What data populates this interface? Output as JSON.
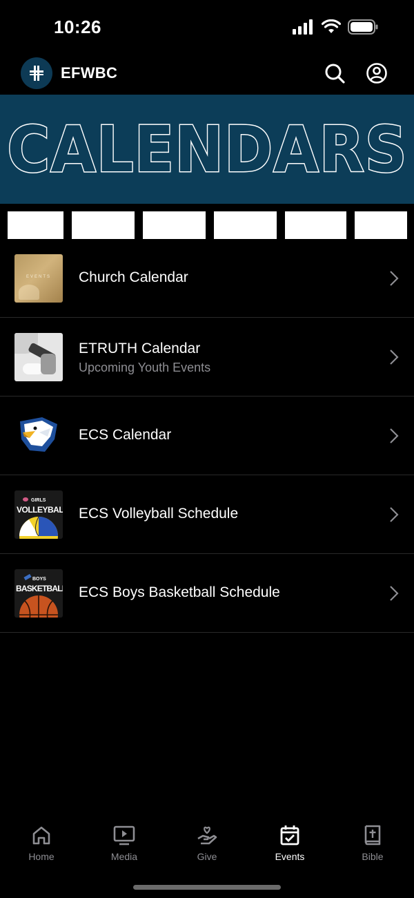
{
  "status": {
    "time": "10:26"
  },
  "header": {
    "app_name": "EFWBC"
  },
  "banner": {
    "title": "CALENDARS"
  },
  "calendars": [
    {
      "title": "Church Calendar",
      "subtitle": "",
      "thumb_text": "EVENTS",
      "thumb_icon": "events-photo-thumbnail"
    },
    {
      "title": "ETRUTH Calendar",
      "subtitle": "Upcoming Youth Events",
      "thumb_text": "",
      "thumb_icon": "youth-photo-thumbnail"
    },
    {
      "title": "ECS Calendar",
      "subtitle": "",
      "thumb_text": "",
      "thumb_icon": "eagle-logo-thumbnail"
    },
    {
      "title": "ECS Volleyball Schedule",
      "subtitle": "",
      "thumb_text": "GIRLS",
      "thumb_text2": "VOLLEYBALL",
      "thumb_icon": "volleyball-thumbnail"
    },
    {
      "title": "ECS Boys Basketball Schedule",
      "subtitle": "",
      "thumb_text": "BOYS",
      "thumb_text2": "BASKETBALL",
      "thumb_icon": "basketball-thumbnail"
    }
  ],
  "tabs": [
    {
      "label": "Home",
      "icon": "home-icon",
      "active": false
    },
    {
      "label": "Media",
      "icon": "media-icon",
      "active": false
    },
    {
      "label": "Give",
      "icon": "give-icon",
      "active": false
    },
    {
      "label": "Events",
      "icon": "events-icon",
      "active": true
    },
    {
      "label": "Bible",
      "icon": "bible-icon",
      "active": false
    }
  ],
  "colors": {
    "background": "#000000",
    "banner": "#0c3d58",
    "logo_bg": "#0d3a55",
    "muted": "#8e8e93"
  }
}
